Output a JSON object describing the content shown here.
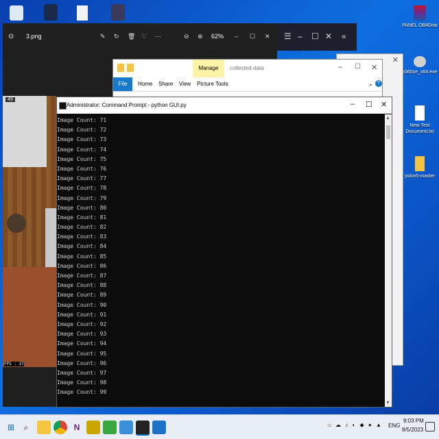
{
  "desktop": {
    "icons_right": [
      {
        "label": "PANEL OB4Drar",
        "icon": "winrar-icon"
      },
      {
        "label": "x360ce_x64.exe",
        "icon": "gamepad-icon"
      },
      {
        "label": "New Text Document.txt",
        "icon": "text-file-icon"
      },
      {
        "label": "yolov5-master",
        "icon": "folder-icon"
      }
    ]
  },
  "photos": {
    "filename": "3.png",
    "zoom": "62%"
  },
  "game": {
    "badge": "49",
    "fps_label": "FPS : 37"
  },
  "explorer": {
    "manage_label": "Manage",
    "title": "collected-data",
    "tabs": [
      "File",
      "Home",
      "Share",
      "View",
      "Picture Tools"
    ]
  },
  "cmd": {
    "title": "Administrator: Command Prompt - python  GUI.py",
    "lines": [
      "Image Count: 71",
      "Image Count: 72",
      "Image Count: 73",
      "Image Count: 74",
      "Image Count: 75",
      "Image Count: 76",
      "Image Count: 77",
      "Image Count: 78",
      "Image Count: 79",
      "Image Count: 80",
      "Image Count: 81",
      "Image Count: 82",
      "Image Count: 83",
      "Image Count: 84",
      "Image Count: 85",
      "Image Count: 86",
      "Image Count: 87",
      "Image Count: 88",
      "Image Count: 89",
      "Image Count: 90",
      "Image Count: 91",
      "Image Count: 92",
      "Image Count: 93",
      "Image Count: 94",
      "Image Count: 95",
      "Image Count: 96",
      "Image Count: 97",
      "Image Count: 98",
      "Image Count: 99"
    ]
  },
  "taskbar": {
    "language": "ENG",
    "time": "9:03 PM",
    "date": "8/5/2023"
  }
}
